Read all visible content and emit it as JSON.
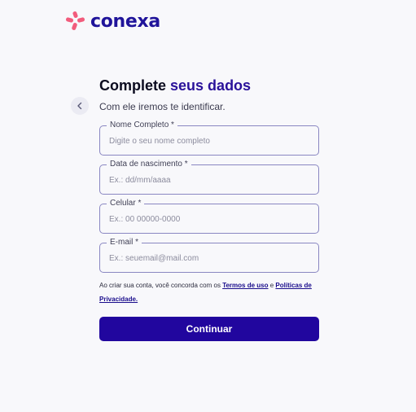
{
  "brand": {
    "name": "conexa",
    "accent_color": "#f25c7c",
    "primary_color": "#21069e"
  },
  "header": {
    "title_plain": "Complete",
    "title_accent": "seus dados",
    "subtitle": "Com ele iremos te identificar."
  },
  "form": {
    "full_name": {
      "label": "Nome Completo *",
      "placeholder": "Digite o seu nome completo",
      "value": ""
    },
    "birth_date": {
      "label": "Data de nascimento *",
      "placeholder": "Ex.: dd/mm/aaaa",
      "value": ""
    },
    "phone": {
      "label": "Celular *",
      "placeholder": "Ex.: 00 00000-0000",
      "value": ""
    },
    "email": {
      "label": "E-mail *",
      "placeholder": "Ex.: seuemail@mail.com",
      "value": ""
    }
  },
  "terms": {
    "prefix": "Ao criar sua conta, você concorda com os ",
    "terms_link": "Termos de uso",
    "connector": " e ",
    "privacy_link": "Políticas de Privacidade."
  },
  "actions": {
    "continue_label": "Continuar"
  },
  "icons": {
    "logo": "conexa-logo-icon",
    "back": "chevron-left-icon"
  }
}
